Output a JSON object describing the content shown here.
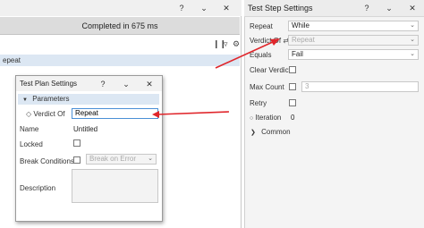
{
  "left_panel": {
    "status_text": "Completed in 675 ms",
    "first_row_label": "epeat",
    "titlebar_icons": [
      "help-icon",
      "chevron-down-icon",
      "close-icon"
    ],
    "toolbar_icons": [
      "columns-icon",
      "filter-icon",
      "settings-icon"
    ]
  },
  "test_step_settings": {
    "title": "Test Step Settings",
    "repeat_label": "Repeat",
    "repeat_value": "While",
    "verdict_of_label": "Verdict Of",
    "verdict_of_value": "Repeat",
    "equals_label": "Equals",
    "equals_value": "Fail",
    "clear_verdict_label": "Clear Verdict",
    "max_count_label": "Max Count",
    "max_count_value": "3",
    "retry_label": "Retry",
    "iteration_label": "Iteration",
    "iteration_value": "0",
    "common_label": "Common"
  },
  "test_plan_settings": {
    "title": "Test Plan Settings",
    "parameters_label": "Parameters",
    "verdict_of_label": "Verdict Of",
    "verdict_of_value": "Repeat",
    "name_label": "Name",
    "name_value": "Untitled",
    "locked_label": "Locked",
    "break_conditions_label": "Break Conditions",
    "break_conditions_value": "Break on Error",
    "description_label": "Description"
  },
  "colors": {
    "annotation_arrow": "#e0262b",
    "selection_blue": "#dce7f3",
    "focus_border": "#4a8fd6"
  }
}
